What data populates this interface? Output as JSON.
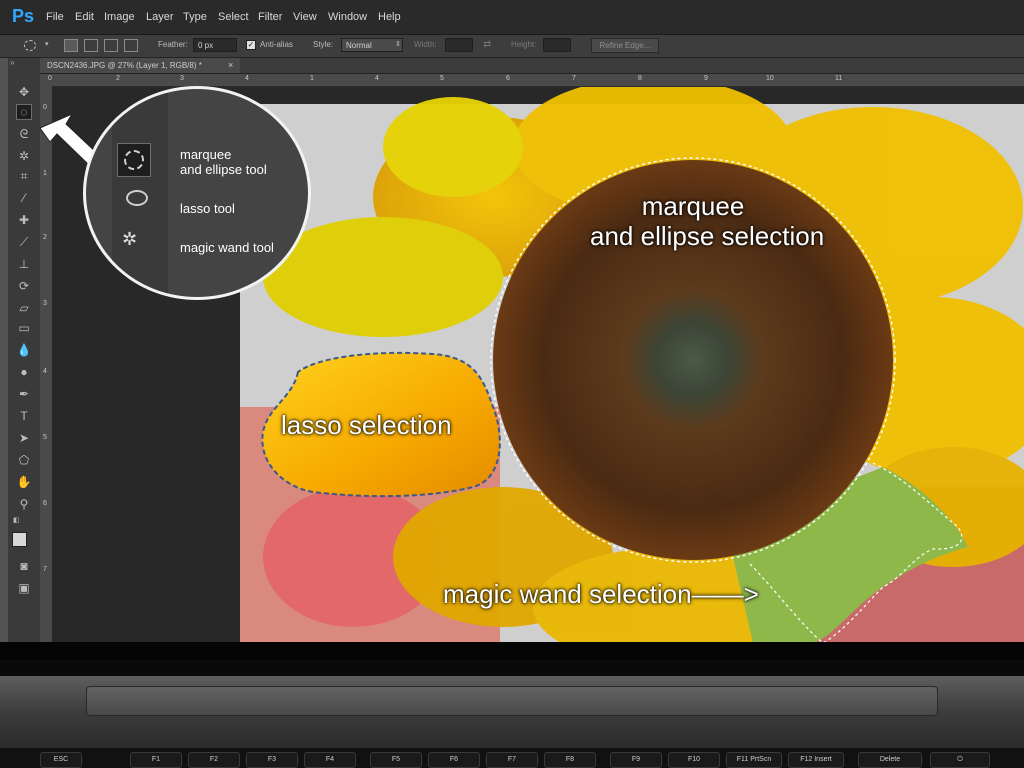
{
  "app": {
    "logo": "Ps",
    "menu": [
      "File",
      "Edit",
      "Image",
      "Layer",
      "Type",
      "Select",
      "Filter",
      "View",
      "Window",
      "Help"
    ]
  },
  "options": {
    "feather_label": "Feather:",
    "feather_value": "0 px",
    "antialias_label": "Anti-alias",
    "antialias_checked": true,
    "style_label": "Style:",
    "style_value": "Normal",
    "width_label": "Width:",
    "height_label": "Height:",
    "refine_edge_label": "Refine Edge..."
  },
  "document": {
    "tab_title": "DSCN2436.JPG @ 27% (Layer 1, RGB/8) *",
    "close_glyph": "×"
  },
  "rulers": {
    "top": [
      "0",
      "1",
      "2",
      "3",
      "4",
      "5",
      "6",
      "7",
      "8",
      "9",
      "10",
      "11"
    ],
    "left": [
      "0",
      "1",
      "2",
      "3",
      "4",
      "5",
      "6",
      "7"
    ]
  },
  "toolbar": {
    "tools": [
      "move-tool",
      "marquee-tool",
      "lasso-tool",
      "magic-wand-tool",
      "crop-tool",
      "eyedropper-tool",
      "healing-brush-tool",
      "brush-tool",
      "clone-stamp-tool",
      "history-brush-tool",
      "eraser-tool",
      "gradient-tool",
      "blur-tool",
      "dodge-tool",
      "pen-tool",
      "type-tool",
      "path-selection-tool",
      "shape-tool",
      "hand-tool",
      "zoom-tool"
    ]
  },
  "callout": {
    "marquee_label_1": "marquee",
    "marquee_label_2": "and ellipse tool",
    "lasso_label": "lasso tool",
    "magic_wand_label": "magic wand tool"
  },
  "annotations": {
    "marquee_selection_1": "marquee",
    "marquee_selection_2": "and ellipse selection",
    "lasso_selection": "lasso selection",
    "magic_wand_selection": "magic wand selection——>"
  },
  "keyboard": {
    "keys": [
      "ESC",
      "F1",
      "F2",
      "F3",
      "F4",
      "F5",
      "F6",
      "F7",
      "F8",
      "F9",
      "F10",
      "F11 PrtScn",
      "F12 Insert",
      "Delete",
      "⏻"
    ]
  },
  "colors": {
    "ps_blue": "#31a8ff",
    "selection_line": "#ffffff",
    "lasso_outline": "#3a5a8c"
  }
}
